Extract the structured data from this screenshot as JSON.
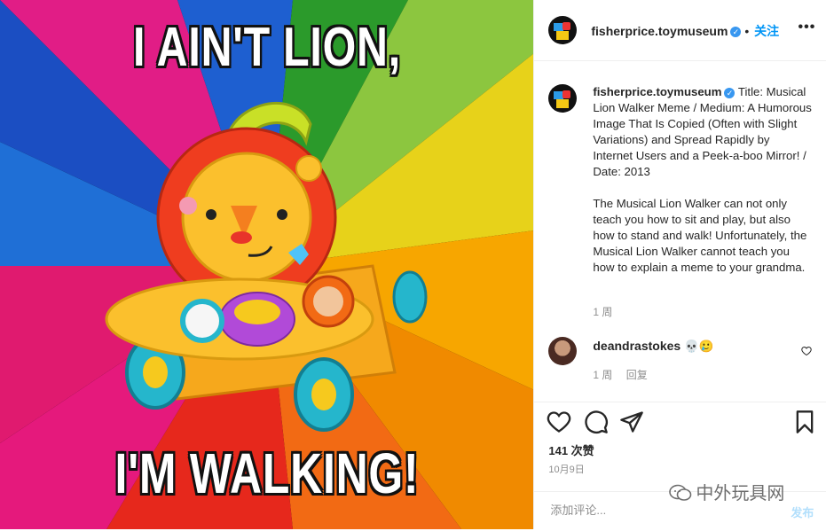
{
  "post": {
    "meme_top": "I AIN'T LION,",
    "meme_bottom": "I'M WALKING!",
    "author": "fisherprice.toymuseum",
    "follow_label": "关注",
    "caption": "Title: Musical Lion Walker Meme / Medium: A Humorous Image That Is Copied (Often with Slight Variations) and Spread Rapidly by Internet Users and a Peek-a-boo Mirror! / Date: 2013\n\nThe Musical Lion Walker can not only teach you how to sit and play, but also how to stand and walk! Unfortunately, the Musical Lion Walker cannot teach you how to explain a meme to your grandma.",
    "caption_age": "1 周",
    "likes": "141 次赞",
    "date": "10月9日"
  },
  "comment": {
    "user": "deandrastokes",
    "text": "💀🥲",
    "age": "1 周",
    "reply_label": "回复"
  },
  "composer": {
    "placeholder": "添加评论...",
    "post_label": "发布"
  },
  "watermark": "中外玩具网",
  "icons": {
    "more": "more-icon",
    "like": "heart-icon",
    "comment": "comment-icon",
    "share": "share-icon",
    "save": "bookmark-icon",
    "verified": "verified-icon"
  },
  "colors": {
    "link_blue": "#0095f6",
    "verified_blue": "#3897f0",
    "meta_gray": "#8e8e8e"
  }
}
